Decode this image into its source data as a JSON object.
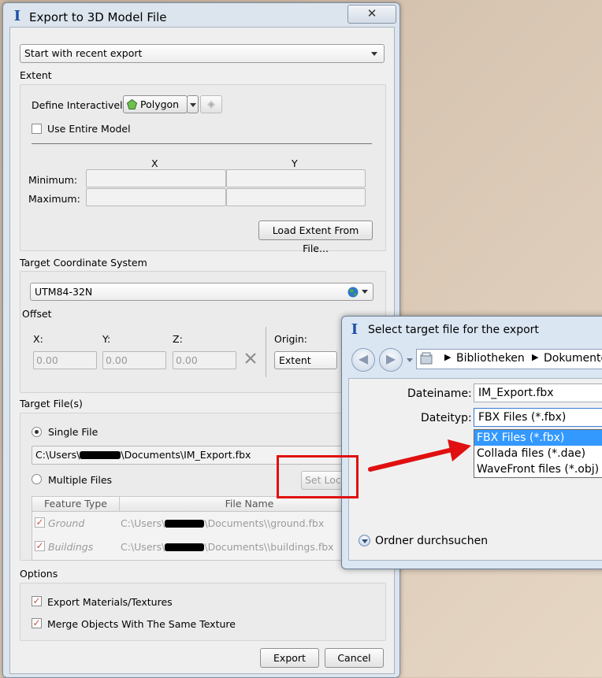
{
  "dialog": {
    "title": "Export to 3D Model File",
    "close_glyph": "✕",
    "preset": "Start with recent export",
    "extent": {
      "label": "Extent",
      "define_label": "Define Interactively:",
      "define_value": "Polygon",
      "use_entire_model": "Use Entire Model",
      "col_x": "X",
      "col_y": "Y",
      "minimum_label": "Minimum:",
      "maximum_label": "Maximum:",
      "load_button": "Load Extent From File..."
    },
    "tcs": {
      "label": "Target Coordinate System",
      "value": "UTM84-32N",
      "offset_label": "Offset",
      "x_label": "X:",
      "y_label": "Y:",
      "z_label": "Z:",
      "x_value": "0.00",
      "y_value": "0.00",
      "z_value": "0.00",
      "origin_label": "Origin:",
      "origin_value": "Extent"
    },
    "target_files": {
      "label": "Target File(s)",
      "single_file": "Single File",
      "path_prefix": "C:\\Users\\",
      "path_suffix": "\\Documents\\IM_Export.fbx",
      "multiple_files": "Multiple Files",
      "set_location_button": "Set Loca",
      "col_feature_type": "Feature Type",
      "col_file_name": "File Name",
      "rows": [
        {
          "feature": "Ground",
          "prefix": "C:\\Users\\",
          "suffix": "\\Documents\\\\ground.fbx"
        },
        {
          "feature": "Buildings",
          "prefix": "C:\\Users\\",
          "suffix": "\\Documents\\\\buildings.fbx"
        }
      ]
    },
    "options": {
      "label": "Options",
      "export_materials": "Export Materials/Textures",
      "merge_objects": "Merge Objects With The Same Texture"
    },
    "export_button": "Export",
    "cancel_button": "Cancel"
  },
  "file_dialog": {
    "title": "Select target file for the export",
    "breadcrumb": [
      "Bibliotheken",
      "Dokumente"
    ],
    "filename_label": "Dateiname:",
    "filename_value": "IM_Export.fbx",
    "filetype_label": "Dateityp:",
    "filetype_value": "FBX Files (*.fbx)",
    "filetype_options": [
      "FBX Files (*.fbx)",
      "Collada files (*.dae)",
      "WaveFront files (*.obj)"
    ],
    "browse_folders": "Ordner durchsuchen"
  },
  "colors": {
    "highlight": "#e01010",
    "selection": "#3399ff",
    "check": "#d2503a"
  }
}
